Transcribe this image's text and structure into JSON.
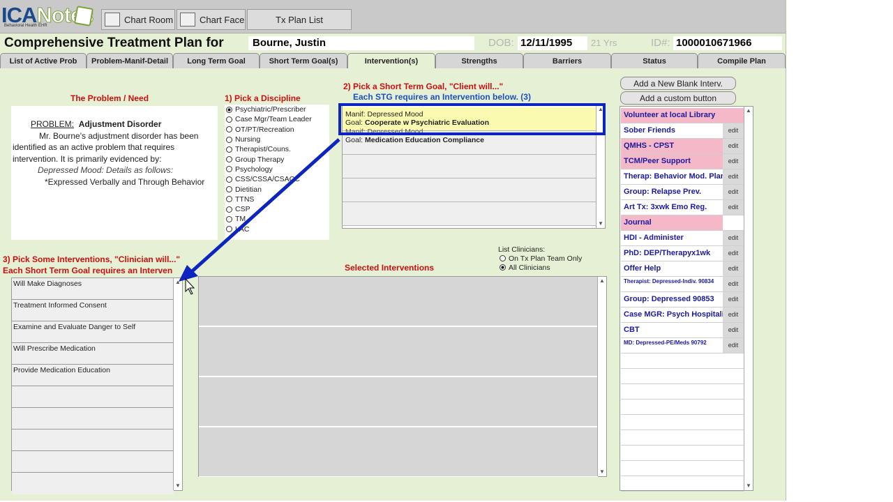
{
  "logo": {
    "brand_a": "ICA",
    "brand_b": "Notes",
    "tagline": "Behavioral Health EHR"
  },
  "toolbar": {
    "chart_room": "Chart Room",
    "chart_face": "Chart Face",
    "tx_plan_list": "Tx Plan List"
  },
  "header": {
    "title": "Comprehensive Treatment Plan for",
    "patient_name": "Bourne, Justin",
    "dob_label": "DOB:",
    "dob": "12/11/1995",
    "age": "21 Yrs",
    "id_label": "ID#:",
    "id": "1000010671966"
  },
  "tabs": [
    "List of Active Prob",
    "Problem-Manif-Detail",
    "Long Term Goal",
    "Short Term Goal(s)",
    "Intervention(s)",
    "Strengths",
    "Barriers",
    "Status",
    "Compile Plan"
  ],
  "problem": {
    "heading": "The Problem / Need",
    "label": "PROBLEM:",
    "name": "Adjustment Disorder",
    "body": "Mr. Bourne's adjustment disorder has been identified as an active problem that requires intervention. It is primarily evidenced by:",
    "detail": "Depressed Mood: Details as follows:",
    "bullet": "*Expressed Verbally and Through Behavior"
  },
  "discipline": {
    "heading": "1) Pick a Discipline",
    "options": [
      "Psychiatric/Prescriber",
      "Case Mgr/Team Leader",
      "OT/PT/Recreation",
      "Nursing",
      "Therapist/Couns.",
      "Group Therapy",
      "Psychology",
      "CSS/CSSA/CSACC",
      "Dietitian",
      "TTNS",
      "CSP",
      "TM",
      "LAC"
    ],
    "selected_index": 0
  },
  "stg": {
    "heading": "2) Pick a Short Term Goal, \"Client will...\"",
    "subheading": "Each STG requires an Intervention below.  (3)",
    "goals": [
      {
        "manif": "Manif: Depressed Mood",
        "goal_label": "Goal:",
        "goal": "Cooperate w Psychiatric Evaluation"
      },
      {
        "manif": "Manif: Depressed Mood",
        "goal_label": "Goal:",
        "goal": "Medication Education Compliance"
      }
    ]
  },
  "interventions": {
    "heading": "3) Pick Some Interventions, \"Clinician will...\"",
    "subheading": "Each Short Term Goal requires an Interven",
    "items": [
      "Will Make Diagnoses",
      "Treatment Informed Consent",
      "Examine and Evaluate Danger to Self",
      "Will Prescribe Medication",
      "Provide Medication Education"
    ]
  },
  "selected": {
    "heading": "Selected Interventions"
  },
  "clinicians": {
    "label": "List Clinicians:",
    "options": [
      "On Tx Plan Team Only",
      "All Clinicians"
    ],
    "selected_index": 1
  },
  "right": {
    "add_blank": "Add a New Blank Interv.",
    "add_custom": "Add a custom button",
    "edit_label": "edit",
    "buttons": [
      {
        "name": "Volunteer at local Library",
        "style": "pinkw"
      },
      {
        "name": "Sober Friends",
        "style": "plain"
      },
      {
        "name": "QMHS - CPST",
        "style": "pink"
      },
      {
        "name": "TCM/Peer Support",
        "style": "pink"
      },
      {
        "name": "Therap: Behavior Mod. Plan",
        "style": "plain"
      },
      {
        "name": "Group:  Relapse Prev.",
        "style": "plain"
      },
      {
        "name": "Art Tx: 3xwk Emo Reg.",
        "style": "plain"
      },
      {
        "name": "Journal",
        "style": "pinkonly"
      },
      {
        "name": "HDI - Administer",
        "style": "plain"
      },
      {
        "name": "PhD: DEP/Therapyx1wk",
        "style": "plain"
      },
      {
        "name": "Offer Help",
        "style": "plain"
      },
      {
        "name": "Therapist: Depressed-Indiv. 90834",
        "style": "small"
      },
      {
        "name": "Group: Depressed 90853",
        "style": "plain"
      },
      {
        "name": "Case MGR: Psych Hospitalization",
        "style": "plain"
      },
      {
        "name": "CBT",
        "style": "plain"
      },
      {
        "name": "MD: Depressed-PE/Meds 90792",
        "style": "small"
      }
    ]
  },
  "colors": {
    "panel_bg": "#e6f0d4",
    "highlight_border": "#0d25c0",
    "selected_goal": "#fafab0",
    "heading_red": "#cc1010",
    "heading_blue": "#1a4fc4",
    "pink": "#f5b8c8"
  }
}
